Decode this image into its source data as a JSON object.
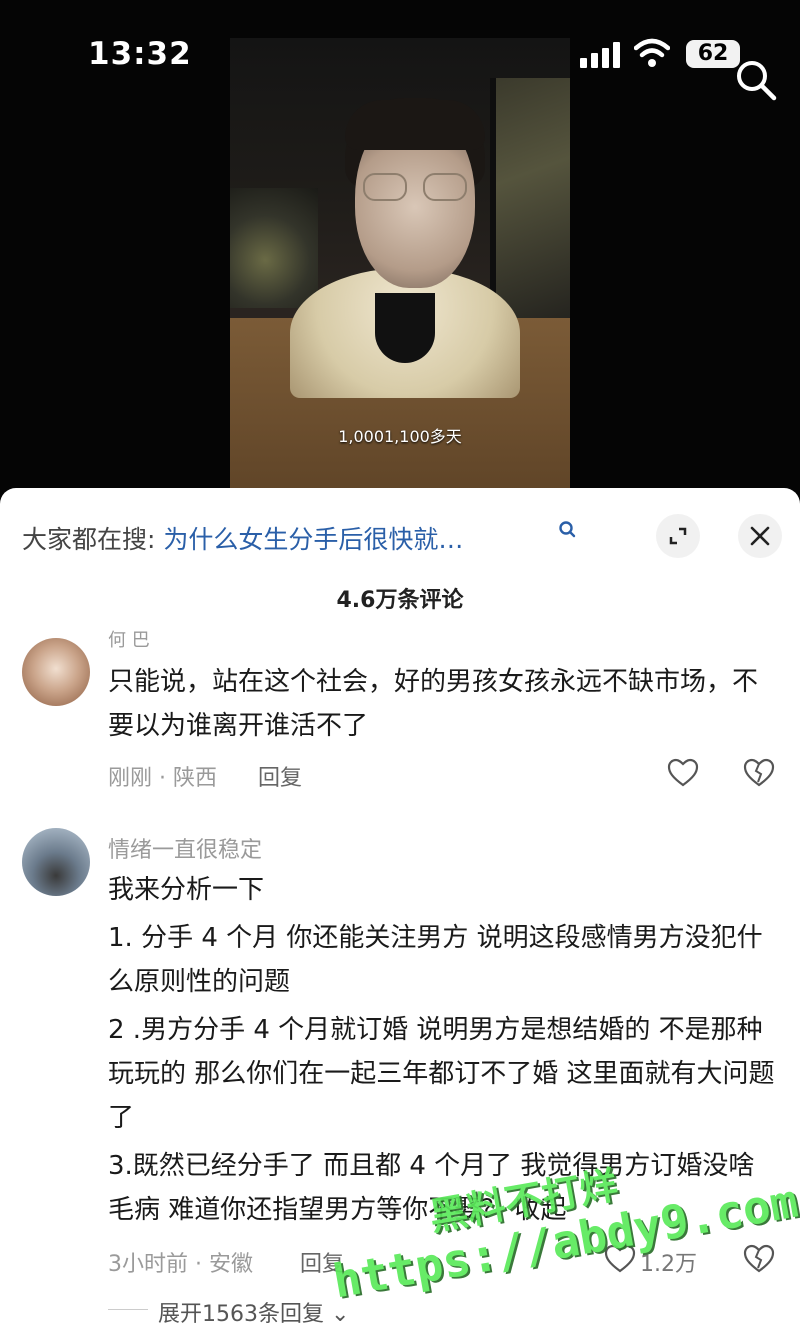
{
  "status_bar": {
    "time": "13:32",
    "battery": "62"
  },
  "video": {
    "caption": "1,0001,100多天"
  },
  "sheet": {
    "hot_search_prefix": "大家都在搜:",
    "hot_search_query": "为什么女生分手后很快就…",
    "comment_count": "4.6万条评论"
  },
  "comments": [
    {
      "author": "何 巴",
      "text": "只能说，站在这个社会，好的男孩女孩永远不缺市场，不要以为谁离开谁活不了",
      "meta": "刚刚 · 陕西",
      "reply_label": "回复",
      "likes": ""
    },
    {
      "author": "情绪一直很稳定",
      "lines": [
        "我来分析一下",
        "1. 分手 4 个月  你还能关注男方  说明这段感情男方没犯什么原则性的问题",
        "2 .男方分手 4 个月就订婚  说明男方是想结婚的  不是那种玩玩的  那么你们在一起三年都订不了婚  这里面就有大问题了",
        "3.既然已经分手了  而且都 4 个月了  我觉得男方订婚没啥毛病  难道你还指望男方等你不娶？  收起"
      ],
      "meta": "3小时前 · 安徽",
      "reply_label": "回复",
      "likes": "1.2万"
    }
  ],
  "expand_replies": "展开1563条回复",
  "watermark": {
    "line1": "黑料不打烊",
    "line2": "https://abdy9.com"
  },
  "colors": {
    "link": "#2a5fa8",
    "watermark": "#5bea5b"
  }
}
